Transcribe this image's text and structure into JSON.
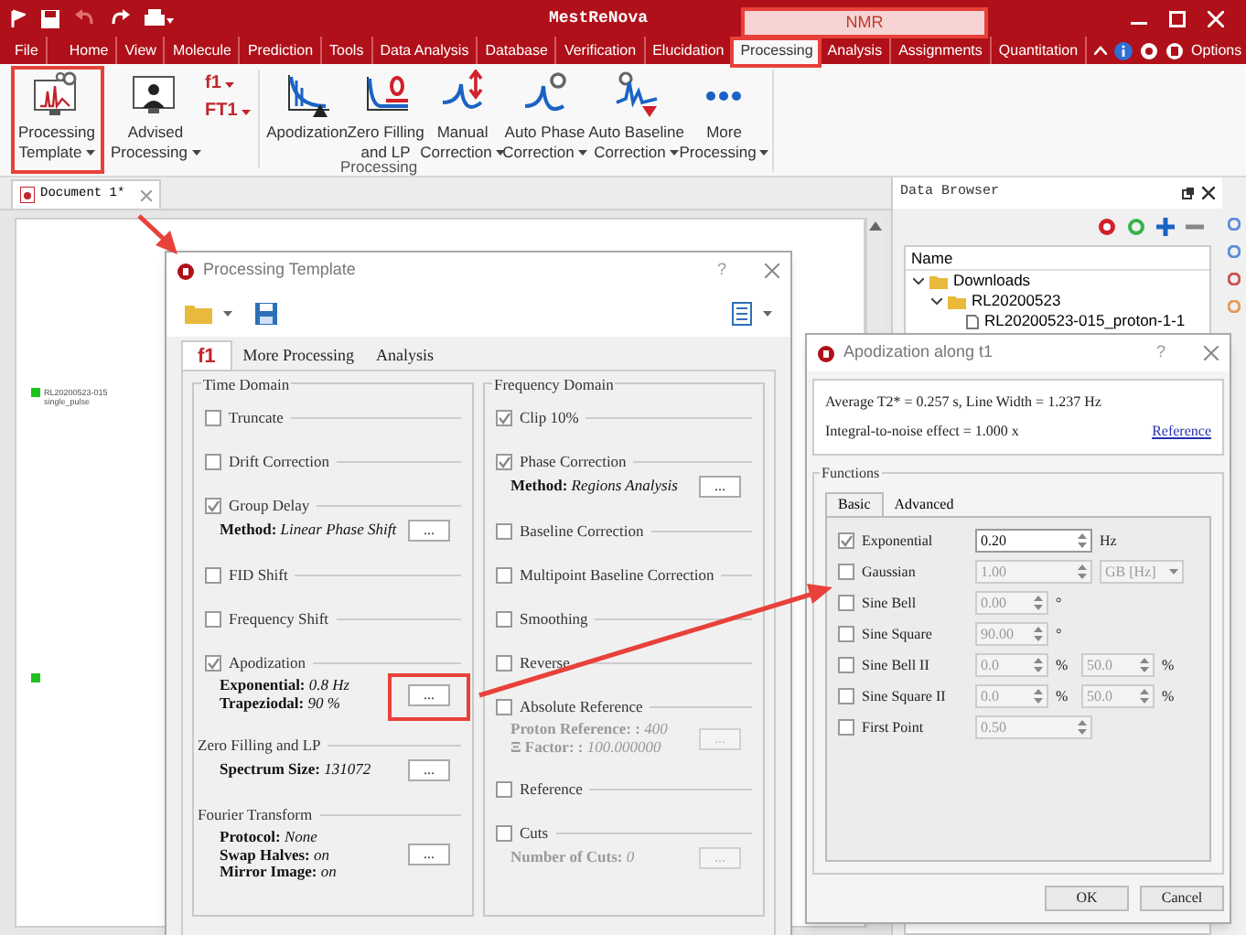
{
  "title_bar": {
    "title": "MestReNova",
    "context_group": "NMR"
  },
  "menu_tabs": [
    {
      "label": "File",
      "selected": false
    },
    {
      "label": "Home",
      "selected": false
    },
    {
      "label": "View",
      "selected": false
    },
    {
      "label": "Molecule",
      "selected": false
    },
    {
      "label": "Prediction",
      "selected": false
    },
    {
      "label": "Tools",
      "selected": false
    },
    {
      "label": "Data Analysis",
      "selected": false
    },
    {
      "label": "Database",
      "selected": false
    },
    {
      "label": "Verification",
      "selected": false
    },
    {
      "label": "Elucidation",
      "selected": false
    },
    {
      "label": "Processing",
      "selected": true
    },
    {
      "label": "Analysis",
      "selected": false
    },
    {
      "label": "Assignments",
      "selected": false
    },
    {
      "label": "Quantitation",
      "selected": false
    }
  ],
  "options_label": "Options",
  "ribbon": {
    "buttons": [
      {
        "lines": [
          "Processing",
          "Template"
        ],
        "dropdown": true
      },
      {
        "lines": [
          "Advised",
          "Processing"
        ],
        "dropdown": true
      },
      {
        "lines": [
          "Apodization"
        ],
        "dropdown": false
      },
      {
        "lines": [
          "Zero Filling",
          "and LP"
        ],
        "dropdown": false
      },
      {
        "lines": [
          "Manual",
          "Correction"
        ],
        "dropdown": true
      },
      {
        "lines": [
          "Auto Phase",
          "Correction"
        ],
        "dropdown": true
      },
      {
        "lines": [
          "Auto Baseline",
          "Correction"
        ],
        "dropdown": true
      },
      {
        "lines": [
          "More",
          "Processing"
        ],
        "dropdown": true
      }
    ],
    "small_buttons": [
      {
        "label": "f1",
        "dropdown": true
      },
      {
        "label": "FT1",
        "dropdown": true
      }
    ],
    "group_label": "Processing"
  },
  "document_tab": "Document 1*",
  "spectrum_label": [
    "RL20200523-015",
    "single_pulse"
  ],
  "data_browser": {
    "title": "Data Browser",
    "column": "Name",
    "tree": [
      {
        "label": "Downloads",
        "expanded": true,
        "children": [
          {
            "label": "RL20200523",
            "expanded": true,
            "children": [
              {
                "label": "RL20200523-015_proton-1-1"
              }
            ]
          }
        ]
      }
    ]
  },
  "processing_template": {
    "title": "Processing Template",
    "help": "?",
    "tabs": [
      {
        "label": "f1",
        "selected": true
      },
      {
        "label": "More Processing",
        "selected": false
      },
      {
        "label": "Analysis",
        "selected": false
      }
    ],
    "columns": [
      {
        "title": "Time Domain",
        "items": [
          {
            "kind": "checkbox",
            "label": "Truncate",
            "checked": false
          },
          {
            "kind": "checkbox",
            "label": "Drift Correction",
            "checked": false
          },
          {
            "kind": "checkbox",
            "label": "Group Delay",
            "checked": true,
            "details": {
              "lines": [
                "**Method:** *Linear Phase Shift*"
              ],
              "button": "...",
              "disabled": false
            }
          },
          {
            "kind": "checkbox",
            "label": "FID Shift",
            "checked": false
          },
          {
            "kind": "checkbox",
            "label": "Frequency Shift",
            "checked": false
          },
          {
            "kind": "checkbox",
            "label": "Apodization",
            "checked": true,
            "details": {
              "lines": [
                "**Exponential:** *0.8 Hz*",
                "**Trapeziodal:** *90 %*"
              ],
              "button": "...",
              "disabled": false
            }
          },
          {
            "kind": "section",
            "label": "Zero Filling and LP",
            "details": {
              "lines": [
                "**Spectrum Size:** *131072*"
              ],
              "button": "...",
              "disabled": false
            }
          },
          {
            "kind": "section",
            "label": "Fourier Transform",
            "details": {
              "lines": [
                "**Protocol:** *None*",
                "**Swap Halves:** *on*",
                "**Mirror Image:** *on*"
              ],
              "button": "...",
              "disabled": false
            }
          }
        ]
      },
      {
        "title": "Frequency Domain",
        "items": [
          {
            "kind": "checkbox",
            "label": "Clip 10%",
            "checked": true
          },
          {
            "kind": "checkbox",
            "label": "Phase Correction",
            "checked": true,
            "details": {
              "lines": [
                "**Method:** *Regions Analysis*"
              ],
              "button": "...",
              "disabled": false
            }
          },
          {
            "kind": "checkbox",
            "label": "Baseline Correction",
            "checked": false
          },
          {
            "kind": "checkbox",
            "label": "Multipoint Baseline Correction",
            "checked": false
          },
          {
            "kind": "checkbox",
            "label": "Smoothing",
            "checked": false
          },
          {
            "kind": "checkbox",
            "label": "Reverse",
            "checked": false
          },
          {
            "kind": "checkbox",
            "label": "Absolute Reference",
            "checked": false,
            "details": {
              "lines": [
                "**Proton Reference: :** *400*",
                "**Ξ Factor: :** *100.000000*"
              ],
              "button": "...",
              "disabled": true
            }
          },
          {
            "kind": "checkbox",
            "label": "Reference",
            "checked": false
          },
          {
            "kind": "checkbox",
            "label": "Cuts",
            "checked": false,
            "details": {
              "lines": [
                "**Number of Cuts:** *0*"
              ],
              "button": "...",
              "disabled": true
            }
          }
        ]
      }
    ]
  },
  "apodization": {
    "title": "Apodization along t1",
    "help": "?",
    "info_lines": [
      "Average T2* = 0.257 s, Line Width = 1.237 Hz",
      "Integral-to-noise effect = 1.000 x"
    ],
    "link": "Reference",
    "group_title": "Functions",
    "tabs": [
      {
        "label": "Basic",
        "selected": true
      },
      {
        "label": "Advanced",
        "selected": false
      }
    ],
    "rows": [
      {
        "label": "Exponential",
        "checked": true,
        "fields": [
          {
            "kind": "spin",
            "wide": true,
            "value": "0.20",
            "unit": "Hz",
            "disabled": false
          }
        ]
      },
      {
        "label": "Gaussian",
        "checked": false,
        "fields": [
          {
            "kind": "spin",
            "wide": true,
            "value": "1.00",
            "disabled": true
          },
          {
            "kind": "select",
            "value": "GB [Hz]",
            "disabled": true
          }
        ]
      },
      {
        "label": "Sine Bell",
        "checked": false,
        "fields": [
          {
            "kind": "spin",
            "wide": false,
            "value": "0.00",
            "unit": "°",
            "disabled": true
          }
        ]
      },
      {
        "label": "Sine Square",
        "checked": false,
        "fields": [
          {
            "kind": "spin",
            "wide": false,
            "value": "90.00",
            "unit": "°",
            "disabled": true
          }
        ]
      },
      {
        "label": "Sine Bell II",
        "checked": false,
        "fields": [
          {
            "kind": "spin",
            "wide": false,
            "value": "0.0",
            "unit": "%",
            "disabled": true
          },
          {
            "kind": "spin",
            "wide": false,
            "value": "50.0",
            "unit": "%",
            "disabled": true
          }
        ]
      },
      {
        "label": "Sine Square II",
        "checked": false,
        "fields": [
          {
            "kind": "spin",
            "wide": false,
            "value": "0.0",
            "unit": "%",
            "disabled": true
          },
          {
            "kind": "spin",
            "wide": false,
            "value": "50.0",
            "unit": "%",
            "disabled": true
          }
        ]
      },
      {
        "label": "First Point",
        "checked": false,
        "fields": [
          {
            "kind": "spin",
            "wide": true,
            "value": "0.50",
            "disabled": true
          }
        ]
      }
    ],
    "buttons": [
      "OK",
      "Cancel"
    ]
  }
}
